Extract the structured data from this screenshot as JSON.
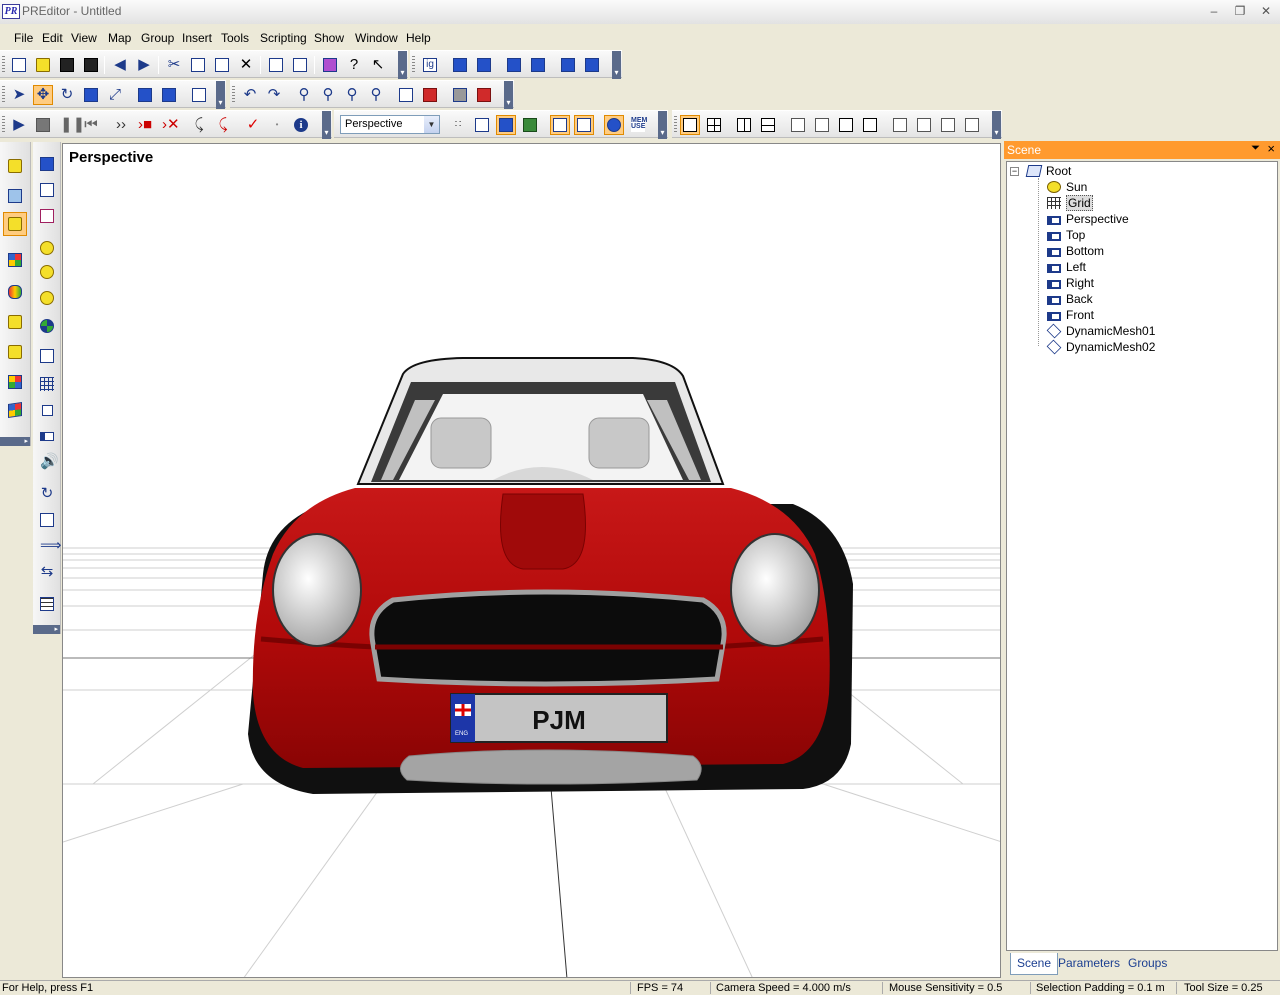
{
  "window": {
    "title": "PREditor - Untitled",
    "app_icon_text": "PR"
  },
  "menu": [
    "File",
    "Edit",
    "View",
    "Map",
    "Group",
    "Insert",
    "Tools",
    "Scripting",
    "Show",
    "Window",
    "Help"
  ],
  "toolbar": {
    "view_dropdown": "Perspective",
    "mem_label": "MEM USE"
  },
  "viewport": {
    "label": "Perspective",
    "plate_text": "PJM",
    "plate_region": "ENG",
    "car_colors": {
      "body": "#b80c0c",
      "body_light": "#e23a2a",
      "trim": "#a0a0a0",
      "windshield": "#3a3a3a"
    }
  },
  "scene_panel": {
    "header": "Scene",
    "tree": {
      "root": "Root",
      "children": [
        "Sun",
        "Grid",
        "Perspective",
        "Top",
        "Bottom",
        "Left",
        "Right",
        "Back",
        "Front",
        "DynamicMesh01",
        "DynamicMesh02"
      ],
      "selected": "Grid"
    },
    "tabs": [
      "Scene",
      "Parameters",
      "Groups"
    ],
    "active_tab": "Scene"
  },
  "status": {
    "help": "For Help, press F1",
    "fps": "FPS = 74",
    "camera_speed": "Camera Speed = 4.000 m/s",
    "mouse_sensitivity": "Mouse Sensitivity = 0.5",
    "selection_padding": "Selection Padding = 0.1 m",
    "tool_size": "Tool Size = 0.25"
  },
  "colors": {
    "accent": "#ff9a2e",
    "selected_tool": "#ffcc80"
  }
}
